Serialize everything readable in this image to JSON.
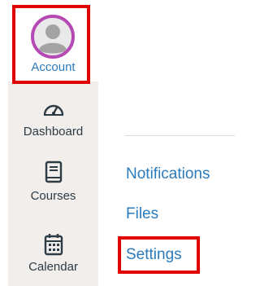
{
  "global_nav": {
    "items": [
      {
        "label": "Account",
        "icon": "user-avatar-icon"
      },
      {
        "label": "Dashboard",
        "icon": "speedometer-icon"
      },
      {
        "label": "Courses",
        "icon": "book-icon"
      },
      {
        "label": "Calendar",
        "icon": "calendar-icon"
      }
    ]
  },
  "account_menu": {
    "items": [
      {
        "label": "Notifications"
      },
      {
        "label": "Files"
      },
      {
        "label": "Settings"
      }
    ]
  },
  "colors": {
    "highlight": "#e00000",
    "link": "#2b7abc",
    "nav_background": "#f1eeeb",
    "avatar_ring": "#b64ab5"
  }
}
